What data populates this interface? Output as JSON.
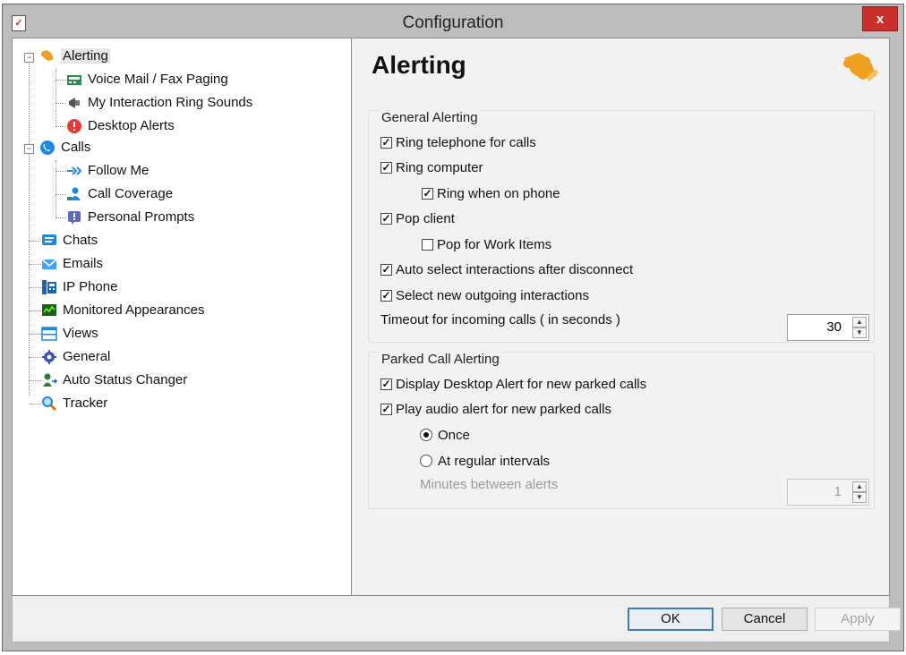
{
  "window": {
    "title": "Configuration",
    "close_label": "x",
    "app_icon_glyph": "✓"
  },
  "tree": {
    "items": [
      {
        "label": "Alerting",
        "icon": "alerting-icon"
      },
      {
        "label": "Voice Mail / Fax Paging",
        "icon": "voicemail-icon"
      },
      {
        "label": "My Interaction Ring Sounds",
        "icon": "megaphone-icon"
      },
      {
        "label": "Desktop Alerts",
        "icon": "alert-icon"
      },
      {
        "label": "Calls",
        "icon": "phone-icon"
      },
      {
        "label": "Follow Me",
        "icon": "follow-me-icon"
      },
      {
        "label": "Call Coverage",
        "icon": "call-coverage-icon"
      },
      {
        "label": "Personal Prompts",
        "icon": "prompt-icon"
      },
      {
        "label": "Chats",
        "icon": "chat-icon"
      },
      {
        "label": "Emails",
        "icon": "email-icon"
      },
      {
        "label": "IP Phone",
        "icon": "ip-phone-icon"
      },
      {
        "label": "Monitored Appearances",
        "icon": "monitor-icon"
      },
      {
        "label": "Views",
        "icon": "views-icon"
      },
      {
        "label": "General",
        "icon": "gear-icon"
      },
      {
        "label": "Auto Status Changer",
        "icon": "status-changer-icon"
      },
      {
        "label": "Tracker",
        "icon": "tracker-icon"
      }
    ]
  },
  "content": {
    "page_title": "Alerting",
    "general": {
      "title": "General Alerting",
      "ring_telephone": {
        "label": "Ring telephone for calls",
        "checked": true
      },
      "ring_computer": {
        "label": "Ring computer",
        "checked": true
      },
      "ring_on_phone": {
        "label": "Ring when on phone",
        "checked": true
      },
      "pop_client": {
        "label": "Pop client",
        "checked": true
      },
      "pop_work_items": {
        "label": "Pop for Work Items",
        "checked": false
      },
      "auto_select": {
        "label": "Auto select interactions after disconnect",
        "checked": true
      },
      "select_outgoing": {
        "label": "Select new outgoing interactions",
        "checked": true
      },
      "timeout_label": "Timeout for incoming calls ( in seconds )",
      "timeout_value": "30"
    },
    "parked": {
      "title": "Parked Call Alerting",
      "display_alert": {
        "label": "Display Desktop Alert for new parked calls",
        "checked": true
      },
      "play_audio": {
        "label": "Play audio alert for new parked calls",
        "checked": true
      },
      "once": {
        "label": "Once",
        "selected": true
      },
      "regular": {
        "label": "At regular intervals",
        "selected": false
      },
      "minutes_label": "Minutes between alerts",
      "minutes_value": "1"
    }
  },
  "footer": {
    "ok": "OK",
    "cancel": "Cancel",
    "apply": "Apply"
  },
  "colors": {
    "accent_orange": "#f0a020",
    "close_red": "#c9302c",
    "default_button_border": "#3c7fb1"
  }
}
